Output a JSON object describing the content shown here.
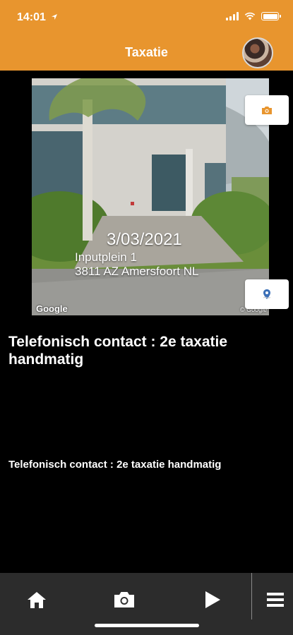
{
  "status_bar": {
    "time": "14:01"
  },
  "header": {
    "title": "Taxatie",
    "accent_color": "#e8952e"
  },
  "photo": {
    "date": "3/03/2021",
    "address_line1": "Inputplein 1",
    "address_line2": "3811 AZ Amersfoort NL",
    "attribution_left": "Google",
    "attribution_right": "© Google"
  },
  "content": {
    "heading": "Telefonisch contact : 2e taxatie handmatig",
    "body": "Telefonisch contact : 2e taxatie handmatig"
  },
  "floating_buttons": {
    "camera_icon": "camera-icon",
    "map_icon": "map-pin-icon"
  },
  "tab_bar": {
    "items": [
      {
        "icon": "home-icon"
      },
      {
        "icon": "camera-icon"
      },
      {
        "icon": "play-icon"
      },
      {
        "icon": "menu-icon"
      }
    ]
  }
}
